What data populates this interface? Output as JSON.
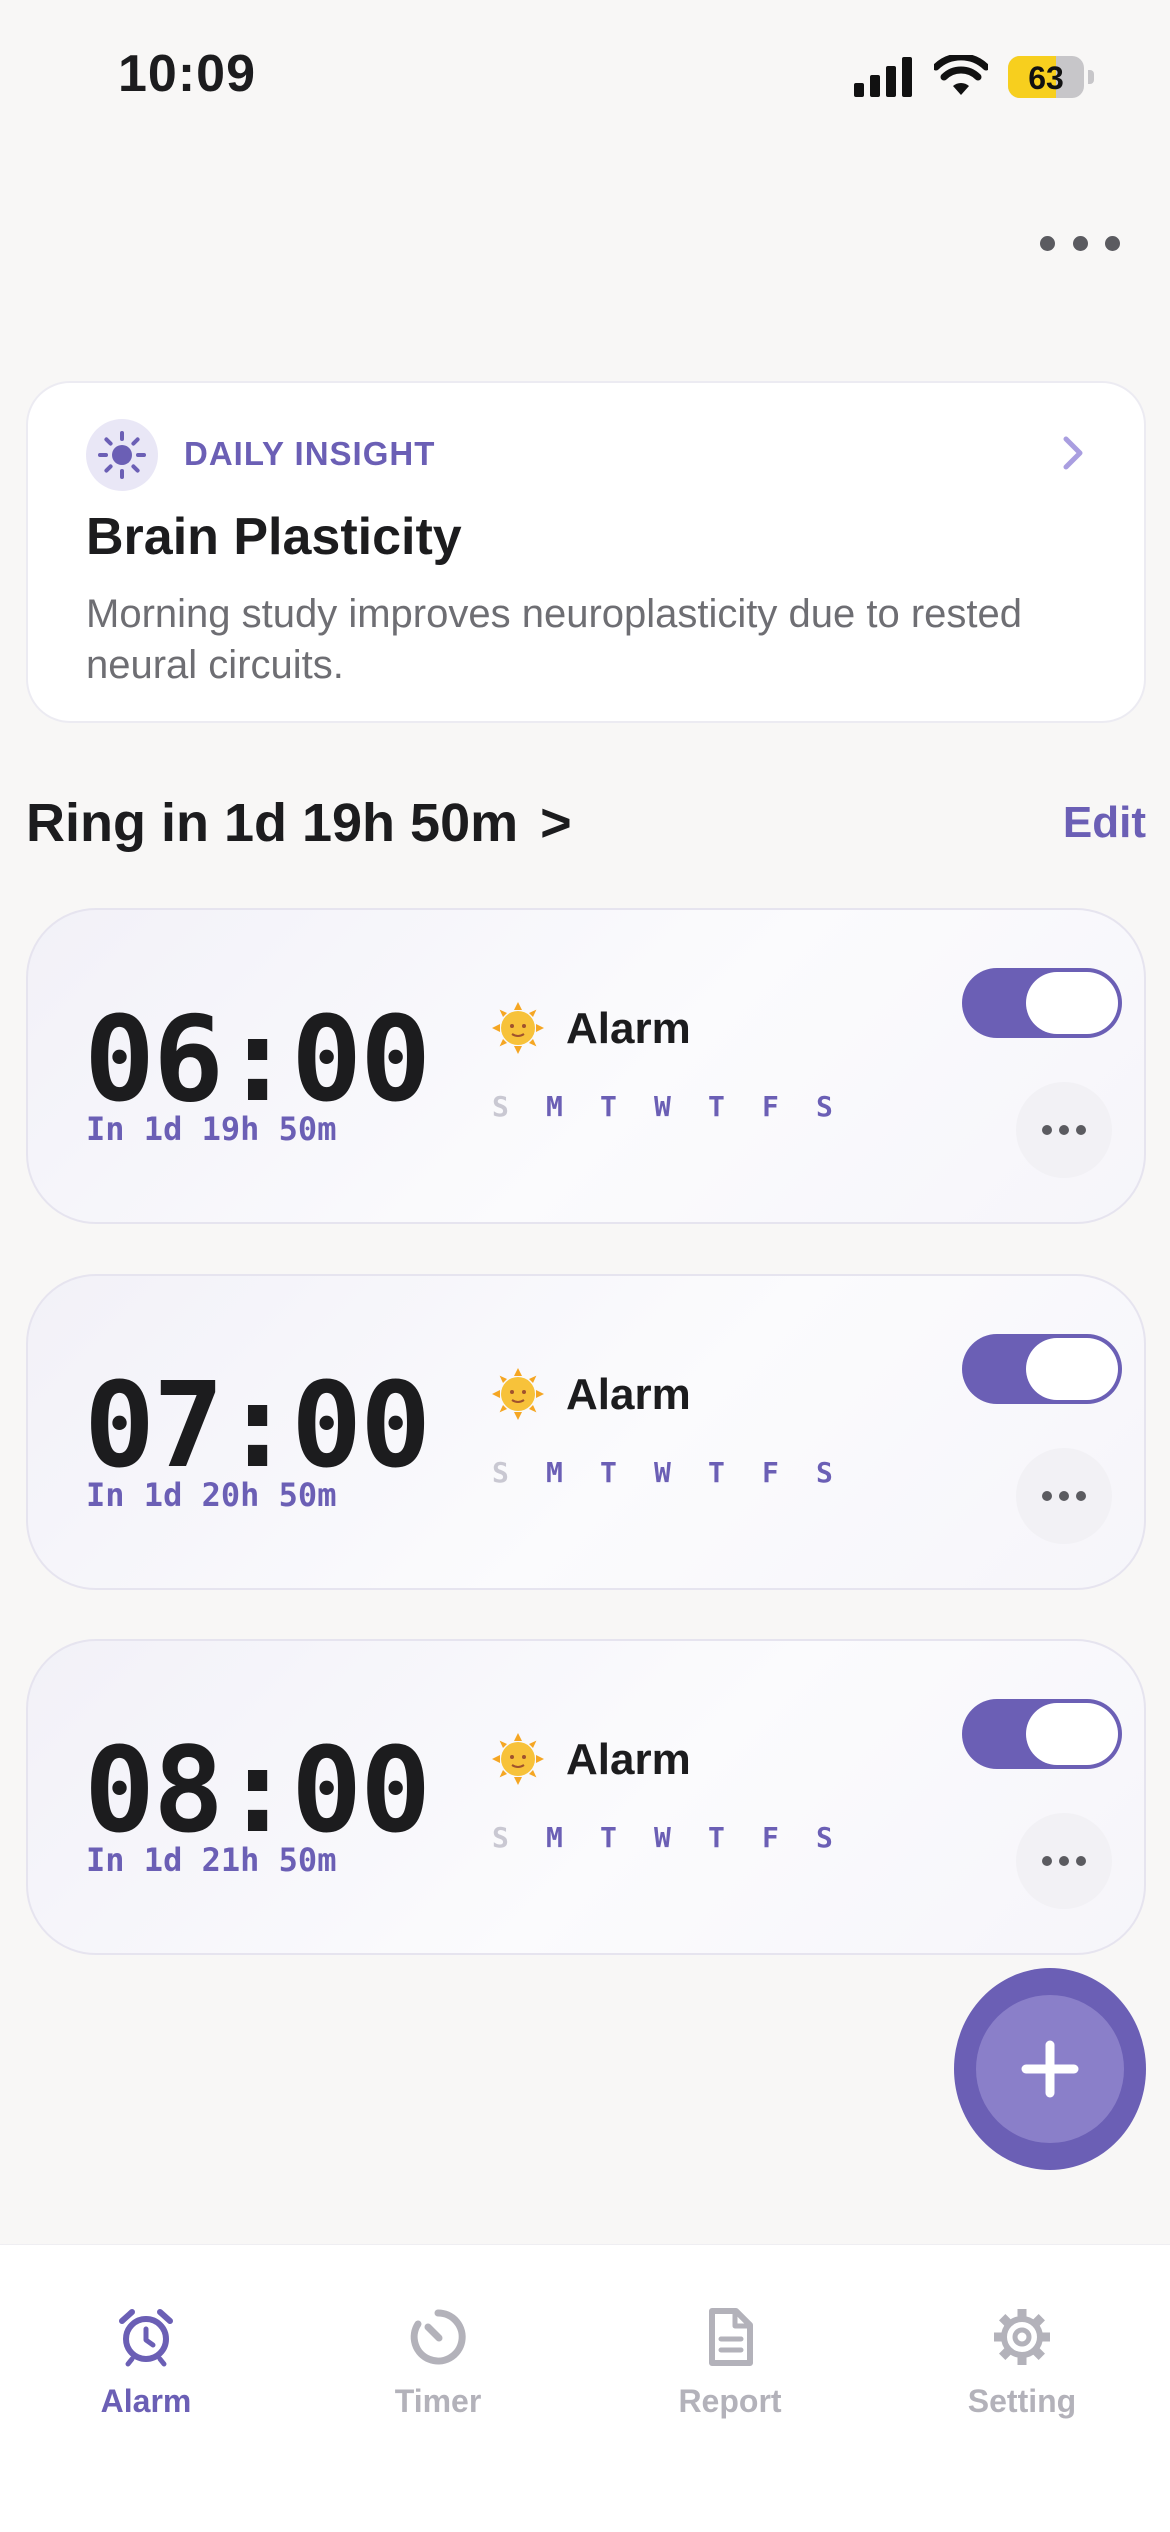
{
  "status_bar": {
    "time": "10:09",
    "battery_level": 63,
    "battery_label": "63"
  },
  "insight": {
    "tag": "DAILY INSIGHT",
    "title": "Brain Plasticity",
    "body": "Morning study improves neuroplasticity due to rested neural circuits.",
    "icon": "sun-icon"
  },
  "ring_header": {
    "text": "Ring in 1d 19h 50m",
    "arrow": ">",
    "edit_label": "Edit"
  },
  "alarms": [
    {
      "time": "06:00",
      "countdown": "In 1d 19h 50m",
      "label": "Alarm",
      "icon": "sun-face-icon",
      "enabled": true,
      "days": [
        {
          "letter": "S",
          "active": false
        },
        {
          "letter": "M",
          "active": true
        },
        {
          "letter": "T",
          "active": true
        },
        {
          "letter": "W",
          "active": true
        },
        {
          "letter": "T",
          "active": true
        },
        {
          "letter": "F",
          "active": true
        },
        {
          "letter": "S",
          "active": true
        }
      ]
    },
    {
      "time": "07:00",
      "countdown": "In 1d 20h 50m",
      "label": "Alarm",
      "icon": "sun-face-icon",
      "enabled": true,
      "days": [
        {
          "letter": "S",
          "active": false
        },
        {
          "letter": "M",
          "active": true
        },
        {
          "letter": "T",
          "active": true
        },
        {
          "letter": "W",
          "active": true
        },
        {
          "letter": "T",
          "active": true
        },
        {
          "letter": "F",
          "active": true
        },
        {
          "letter": "S",
          "active": true
        }
      ]
    },
    {
      "time": "08:00",
      "countdown": "In 1d 21h 50m",
      "label": "Alarm",
      "icon": "sun-face-icon",
      "enabled": true,
      "days": [
        {
          "letter": "S",
          "active": false
        },
        {
          "letter": "M",
          "active": true
        },
        {
          "letter": "T",
          "active": true
        },
        {
          "letter": "W",
          "active": true
        },
        {
          "letter": "T",
          "active": true
        },
        {
          "letter": "F",
          "active": true
        },
        {
          "letter": "S",
          "active": true
        }
      ]
    }
  ],
  "tabs": [
    {
      "label": "Alarm",
      "icon": "alarm-clock-icon",
      "active": true
    },
    {
      "label": "Timer",
      "icon": "timer-icon",
      "active": false
    },
    {
      "label": "Report",
      "icon": "document-icon",
      "active": false
    },
    {
      "label": "Setting",
      "icon": "gear-icon",
      "active": false
    }
  ],
  "colors": {
    "accent": "#6b5fb5",
    "accent_light": "#8a7fc9",
    "background": "#f8f7f6",
    "inactive": "#b3b2ba",
    "battery": "#f7cf1e"
  }
}
